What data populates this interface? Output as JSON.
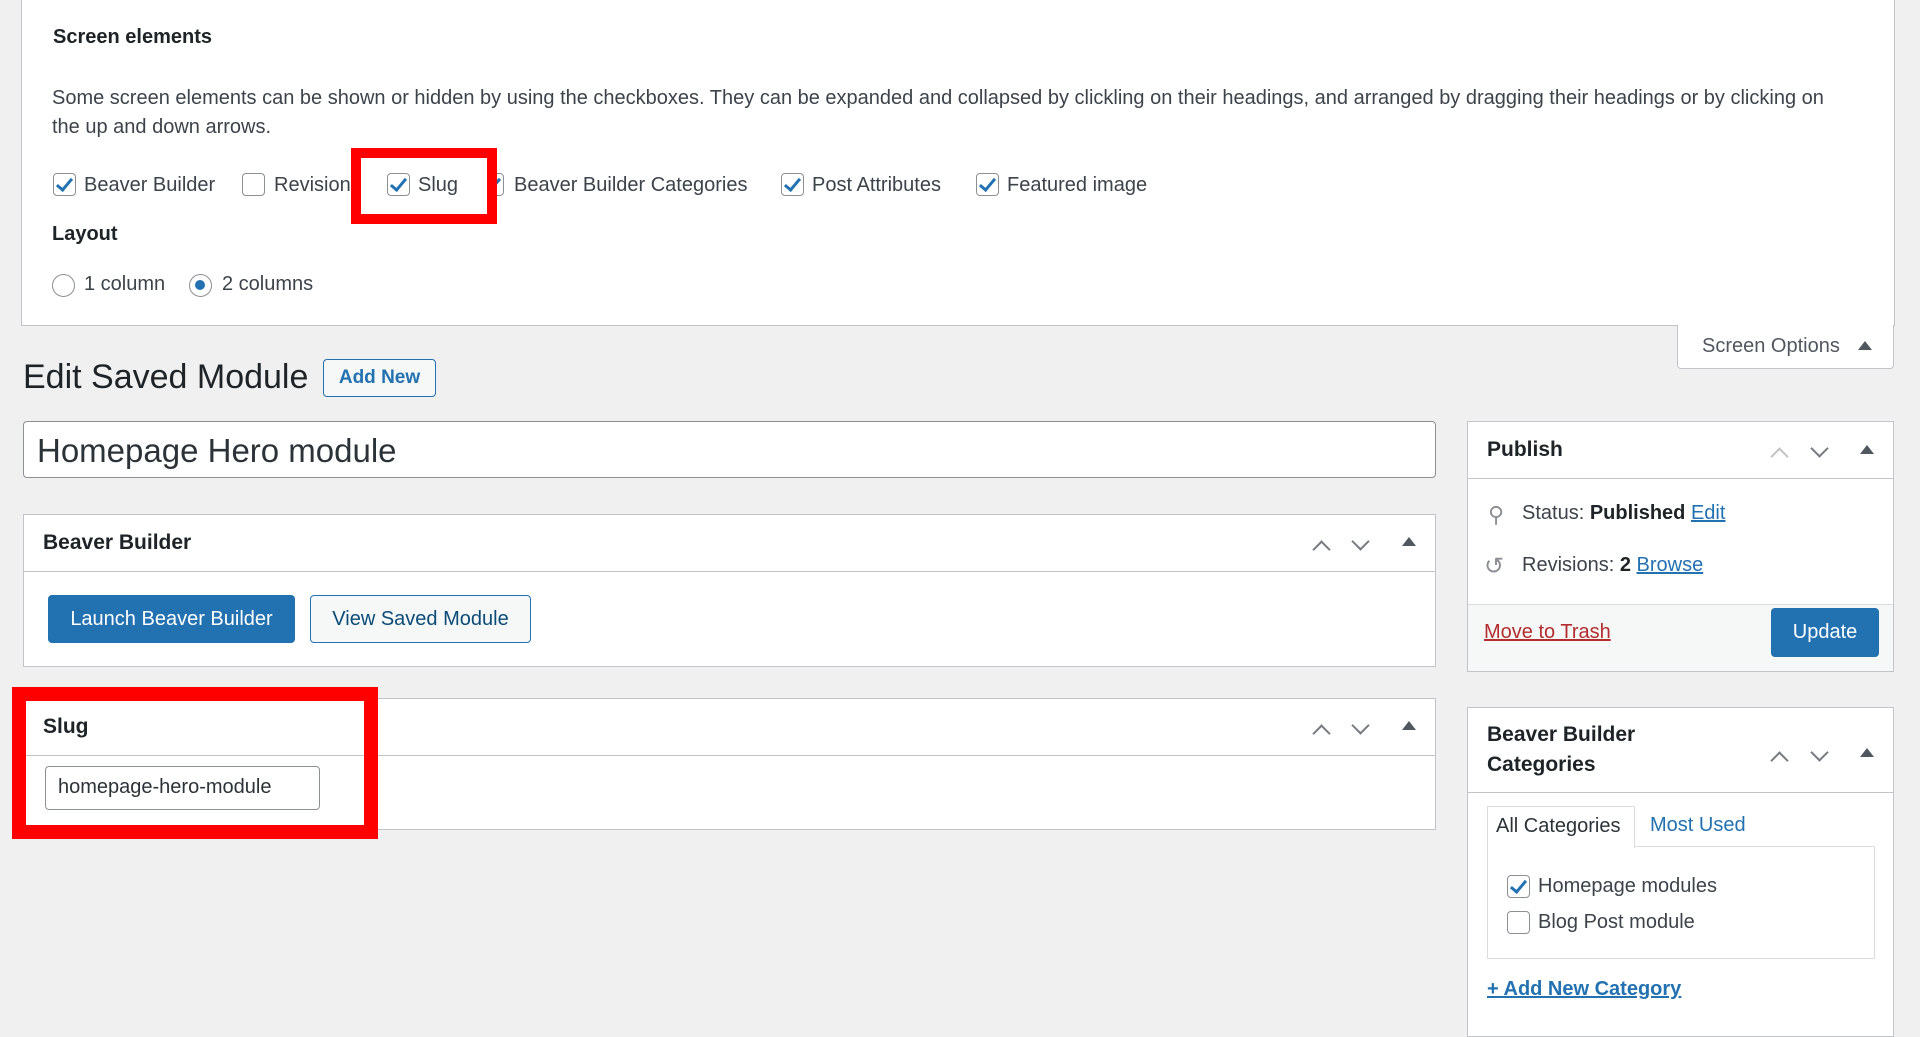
{
  "screen_options": {
    "heading": "Screen elements",
    "description": "Some screen elements can be shown or hidden by using the checkboxes. They can be expanded and collapsed by clickling on their headings, and arranged by dragging their headings or by clicking on the up and down arrows.",
    "checkboxes": [
      {
        "label": "Beaver Builder",
        "checked": true
      },
      {
        "label": "Revision",
        "checked": false
      },
      {
        "label": "Slug",
        "checked": true
      },
      {
        "label": "Beaver Builder Categories",
        "checked": true
      },
      {
        "label": "Post Attributes",
        "checked": true
      },
      {
        "label": "Featured image",
        "checked": true
      }
    ],
    "layout_heading": "Layout",
    "layout_options": [
      {
        "label": "1 column",
        "selected": false
      },
      {
        "label": "2 columns",
        "selected": true
      }
    ],
    "tab_label": "Screen Options"
  },
  "page": {
    "title": "Edit Saved Module",
    "add_new": "Add New",
    "post_title": "Homepage Hero module"
  },
  "beaver_box": {
    "title": "Beaver Builder",
    "launch": "Launch Beaver Builder",
    "view": "View Saved Module"
  },
  "slug_box": {
    "title": "Slug",
    "value": "homepage-hero-module"
  },
  "publish": {
    "title": "Publish",
    "status_label": "Status:",
    "status_value": "Published",
    "edit": "Edit",
    "revisions_label": "Revisions:",
    "revisions_value": "2",
    "browse": "Browse",
    "trash": "Move to Trash",
    "update": "Update"
  },
  "categories": {
    "title_line1": "Beaver Builder",
    "title_line2": "Categories",
    "tabs": [
      "All Categories",
      "Most Used"
    ],
    "items": [
      {
        "label": "Homepage modules",
        "checked": true
      },
      {
        "label": "Blog Post module",
        "checked": false
      }
    ],
    "add_new": "+ Add New Category"
  },
  "colors": {
    "accent": "#2271b1",
    "highlight": "#ff0000",
    "danger": "#b32d2e"
  }
}
